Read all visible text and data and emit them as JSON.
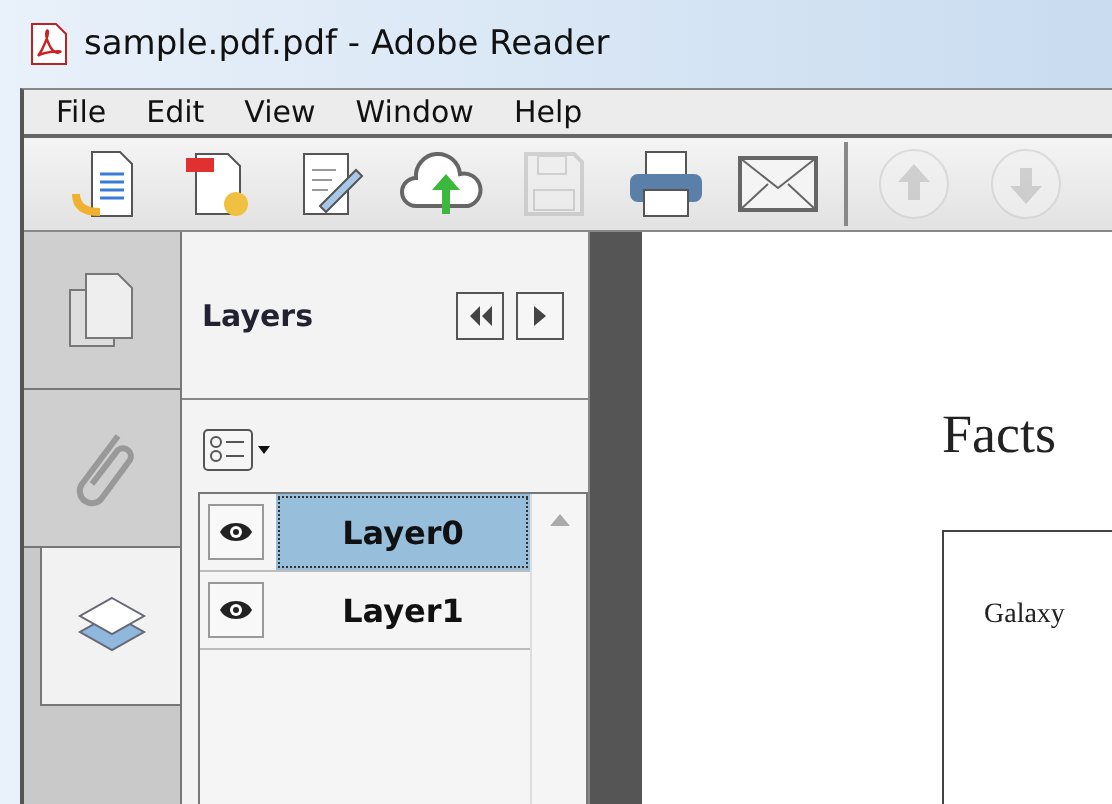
{
  "window": {
    "title": "sample.pdf.pdf - Adobe Reader"
  },
  "menu": [
    "File",
    "Edit",
    "View",
    "Window",
    "Help"
  ],
  "toolbar": [
    {
      "kind": "open",
      "disabled": false
    },
    {
      "kind": "create",
      "disabled": false
    },
    {
      "kind": "edit",
      "disabled": false
    },
    {
      "kind": "upload",
      "disabled": false
    },
    {
      "kind": "save",
      "disabled": true
    },
    {
      "kind": "print",
      "disabled": false
    },
    {
      "kind": "email",
      "disabled": false
    },
    {
      "kind": "separator"
    },
    {
      "kind": "prev",
      "disabled": true
    },
    {
      "kind": "next",
      "disabled": true
    }
  ],
  "side_tabs": [
    {
      "kind": "pages",
      "selected": false
    },
    {
      "kind": "attachments",
      "selected": false
    },
    {
      "kind": "layers",
      "selected": true
    }
  ],
  "layers_panel": {
    "title": "Layers",
    "layers": [
      {
        "name": "Layer0",
        "visible": true,
        "selected": true
      },
      {
        "name": "Layer1",
        "visible": true,
        "selected": false
      }
    ]
  },
  "document": {
    "heading": "Facts",
    "table_cell": "Galaxy"
  }
}
